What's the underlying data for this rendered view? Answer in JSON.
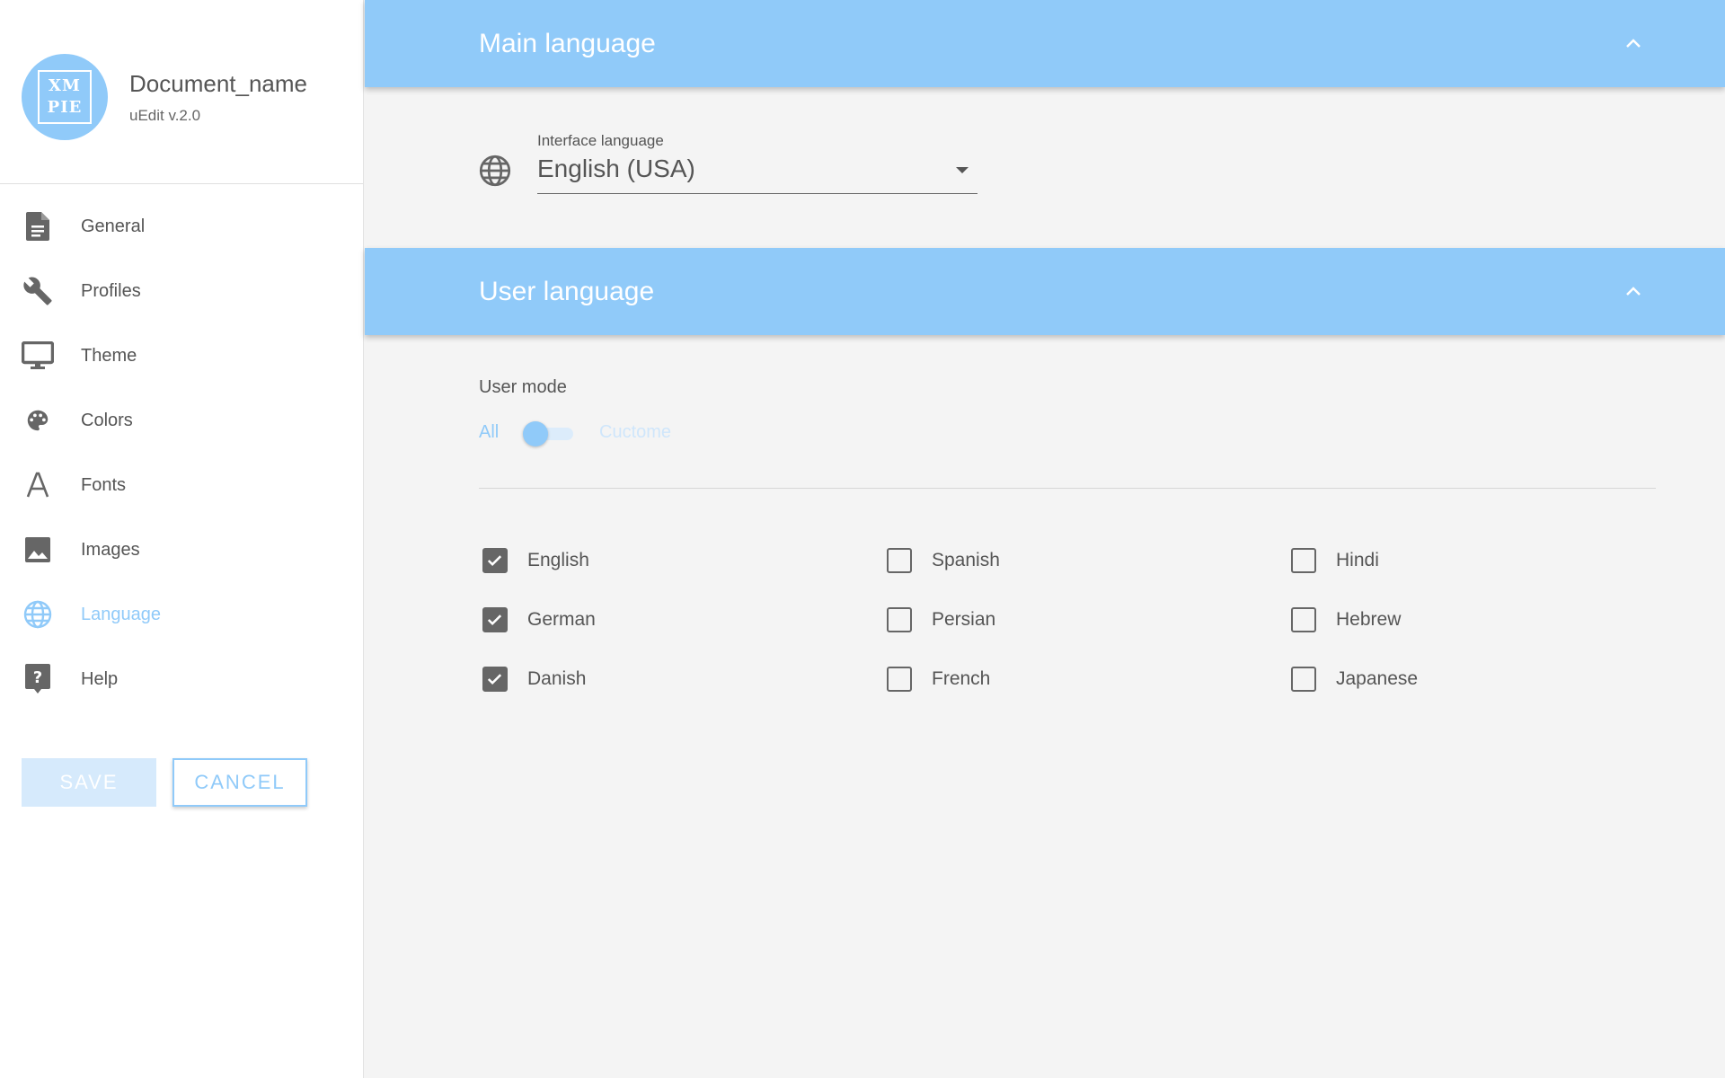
{
  "sidebar": {
    "logo": {
      "line1": "XM",
      "line2": "PIE",
      "mark": "®"
    },
    "doc_name": "Document_name",
    "version": "uEdit v.2.0",
    "items": [
      {
        "label": "General",
        "icon": "document-icon"
      },
      {
        "label": "Profiles",
        "icon": "wrench-icon"
      },
      {
        "label": "Theme",
        "icon": "monitor-icon"
      },
      {
        "label": "Colors",
        "icon": "palette-icon"
      },
      {
        "label": "Fonts",
        "icon": "font-icon"
      },
      {
        "label": "Images",
        "icon": "image-icon"
      },
      {
        "label": "Language",
        "icon": "globe-icon",
        "active": true
      },
      {
        "label": "Help",
        "icon": "help-icon"
      }
    ],
    "save_label": "SAVE",
    "cancel_label": "CANCEL"
  },
  "main_language": {
    "title": "Main language",
    "select_label": "Interface language",
    "select_value": "English (USA)"
  },
  "user_language": {
    "title": "User language",
    "mode_label": "User mode",
    "mode_left": "All",
    "mode_right": "Cuctome",
    "toggle_on": false,
    "languages": [
      {
        "label": "English",
        "checked": true
      },
      {
        "label": "German",
        "checked": true
      },
      {
        "label": "Danish",
        "checked": true
      },
      {
        "label": "Spanish",
        "checked": false
      },
      {
        "label": "Persian",
        "checked": false
      },
      {
        "label": "French",
        "checked": false
      },
      {
        "label": "Hindi",
        "checked": false
      },
      {
        "label": "Hebrew",
        "checked": false
      },
      {
        "label": "Japanese",
        "checked": false
      }
    ]
  },
  "colors": {
    "accent": "#90caf9",
    "text": "#555555",
    "background": "#f4f4f4"
  }
}
